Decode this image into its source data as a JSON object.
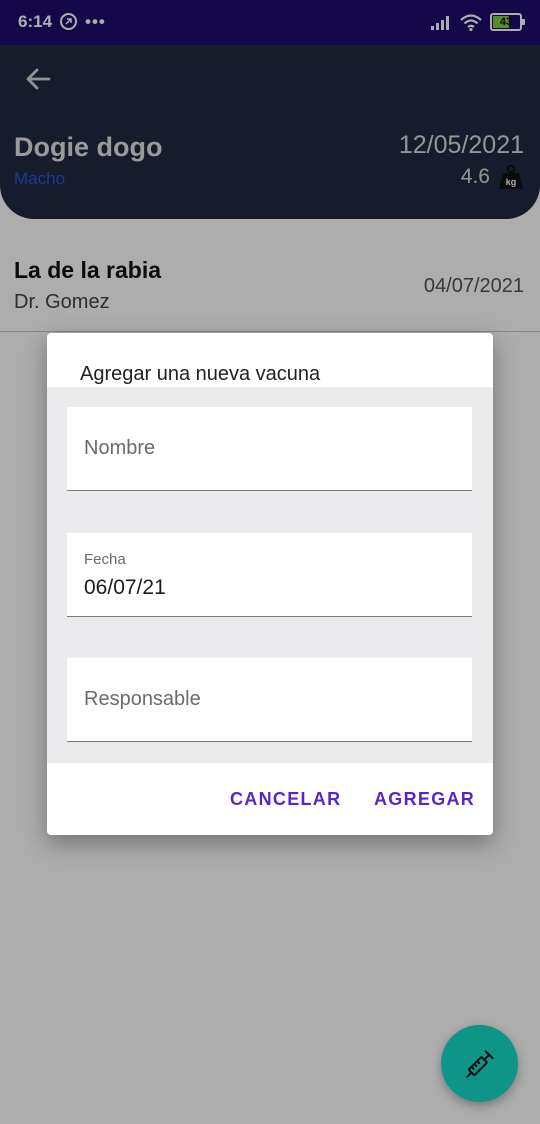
{
  "status_bar": {
    "time": "6:14",
    "battery": "43",
    "icons": [
      "notification-circle-icon",
      "more-dots-icon",
      "signal-icon",
      "wifi-icon",
      "battery-icon"
    ],
    "colors": {
      "background": "#1e0b6e",
      "battery_fill": "#7cd33e"
    }
  },
  "header": {
    "back_icon": "arrow-left-icon",
    "pet_name": "Dogie dogo",
    "pet_sex": "Macho",
    "date": "12/05/2021",
    "weight": "4.6",
    "weight_icon": "kg-weight-icon",
    "weight_icon_label": "kg",
    "colors": {
      "background": "#222a43",
      "sex": "#2f55d4"
    }
  },
  "vaccine_list": [
    {
      "name": "La de la rabia",
      "doctor": "Dr. Gomez",
      "date": "04/07/2021"
    }
  ],
  "dialog": {
    "title": "Agregar una nueva vacuna",
    "fields": {
      "nombre": {
        "placeholder": "Nombre",
        "value": ""
      },
      "fecha": {
        "label": "Fecha",
        "value": "06/07/21"
      },
      "responsable": {
        "placeholder": "Responsable",
        "value": ""
      }
    },
    "buttons": {
      "cancel": "CANCELAR",
      "add": "AGREGAR"
    },
    "colors": {
      "button_text": "#5a24cc",
      "body_background": "#ebebed"
    }
  },
  "fab": {
    "icon": "syringe-icon",
    "color": "#0f9587"
  }
}
